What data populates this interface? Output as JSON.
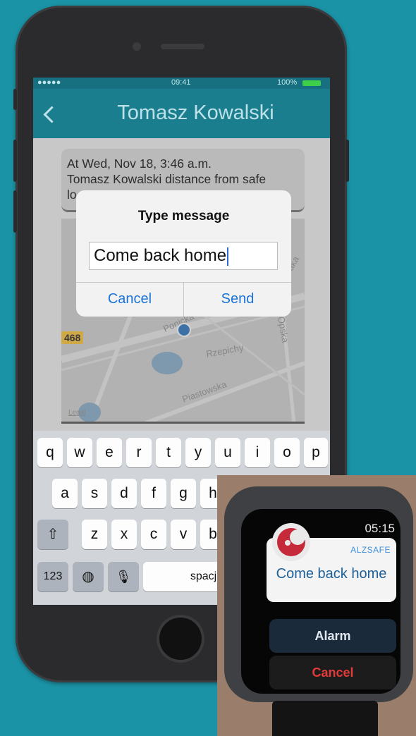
{
  "colors": {
    "background": "#1b93a6",
    "nav_bar": "#1b7e8e",
    "alert_button": "#1a73d9",
    "watch_accent": "#3f8fd6",
    "watch_cancel": "#e33b3b"
  },
  "status_bar": {
    "signal": "●●●●● ",
    "time": "09:41",
    "battery": "100%"
  },
  "nav": {
    "back_icon": "chevron-left-icon",
    "title": "Tomasz Kowalski"
  },
  "message_card": {
    "line1": "At Wed, Nov 18, 3:46 a.m.",
    "line2": "Tomasz Kowalski distance from safe",
    "line3": "lo"
  },
  "map": {
    "road_badge": "468",
    "streets": [
      "Rzepichy",
      "Piastowska",
      "Ponicka",
      "Opska",
      "aka"
    ],
    "legal": "Legal"
  },
  "alert": {
    "title": "Type message",
    "input_value": "Come back home",
    "cancel_label": "Cancel",
    "send_label": "Send"
  },
  "keyboard": {
    "row1": [
      "q",
      "w",
      "e",
      "r",
      "t",
      "y",
      "u",
      "i",
      "o",
      "p"
    ],
    "row2": [
      "a",
      "s",
      "d",
      "f",
      "g",
      "h"
    ],
    "row3": [
      "z",
      "x",
      "c",
      "v",
      "b"
    ],
    "row4": {
      "numbers": "123",
      "space": "spacja"
    }
  },
  "watch": {
    "time": "05:15",
    "app_name": "ALZSAFE",
    "message": "Come back home",
    "alarm_label": "Alarm",
    "cancel_label": "Cancel"
  }
}
